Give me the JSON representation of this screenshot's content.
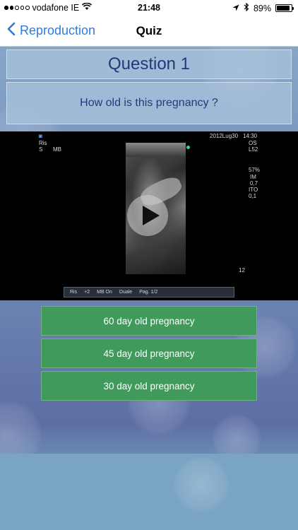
{
  "status_bar": {
    "carrier": "vodafone IE",
    "time": "21:48",
    "battery": "89%",
    "battery_level": 0.89
  },
  "nav": {
    "back_label": "Reproduction",
    "title": "Quiz"
  },
  "quiz": {
    "question_title": "Question 1",
    "question_text": "How old is this pregnancy ?"
  },
  "ultrasound": {
    "header_left_1": "Ris",
    "header_left_2": "S",
    "header_left_3": "MB",
    "date": "2012Lug30",
    "time": "14:30",
    "side_1": "OS",
    "side_2": "L52",
    "side_3": "57%",
    "side_4": "IM",
    "side_5": "0,7",
    "side_6": "ITO",
    "side_7": "0,1",
    "depth": "12",
    "bar_items": [
      "Ris",
      "+2",
      "MB On",
      "Duale",
      "Pag. 1/2"
    ]
  },
  "answers": [
    {
      "label": "60 day old pregnancy"
    },
    {
      "label": "45 day old pregnancy"
    },
    {
      "label": "30 day old pregnancy"
    }
  ],
  "colors": {
    "accent": "#2f7bd6",
    "answer_bg": "#3f9a5c",
    "question_text": "#233a7a"
  }
}
